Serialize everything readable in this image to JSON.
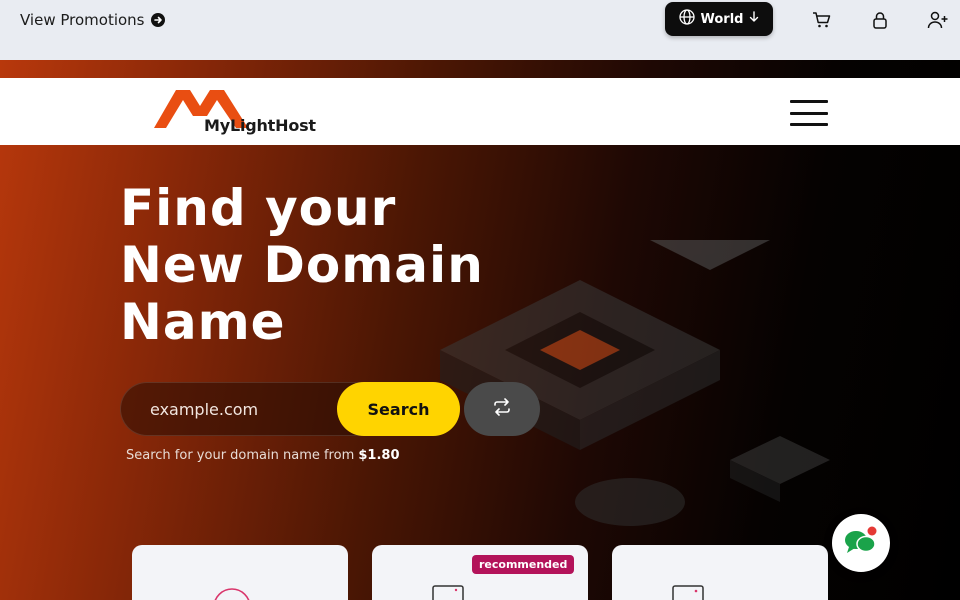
{
  "topbar": {
    "promo_label": "View Promotions",
    "region_label": "World",
    "icons": [
      "cart-icon",
      "lock-icon",
      "add-user-icon"
    ]
  },
  "brand": {
    "name": "MyLightHost",
    "accent": "#e94e12"
  },
  "nav": {
    "menu_icon": "hamburger-icon"
  },
  "hero": {
    "headline_lines": [
      "Find your",
      "New Domain",
      "Name"
    ],
    "search_placeholder": "example.com",
    "search_button": "Search",
    "note_prefix": "Search for your domain name from ",
    "note_price": "$1.80"
  },
  "cards": {
    "badge": "recommended"
  },
  "colors": {
    "search_button": "#ffd400",
    "badge": "#b3135a",
    "chat": "#1aa34a"
  }
}
